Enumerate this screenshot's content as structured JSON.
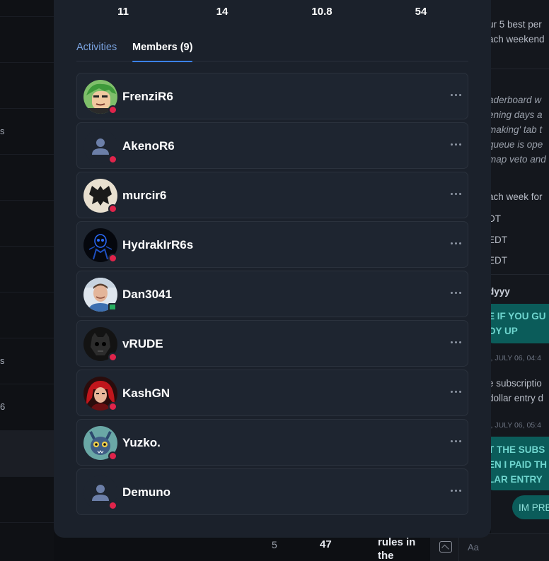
{
  "background": {
    "left_fragments": [
      "s",
      "s",
      "6"
    ],
    "right_lines": [
      {
        "text": "ur 5 best per",
        "style": "normal"
      },
      {
        "text": "ach weekend",
        "style": "normal"
      },
      {
        "text": "aderboard w",
        "style": "i"
      },
      {
        "text": "ening days a",
        "style": "i"
      },
      {
        "text": "making' tab t",
        "style": "i"
      },
      {
        "text": "queue is ope",
        "style": "i"
      },
      {
        "text": "map veto and",
        "style": "i"
      },
      {
        "text": "ach week for",
        "style": "normal"
      },
      {
        "text": "DT",
        "style": "normal"
      },
      {
        "text": " EDT",
        "style": "normal"
      },
      {
        "text": "EDT",
        "style": "normal"
      },
      {
        "text": "dyyy",
        "style": "b"
      },
      {
        "text": "E IF YOU GU",
        "style": "teal"
      },
      {
        "text": "OY UP",
        "style": "teal"
      },
      {
        "text": "), JULY 06, 04:4",
        "style": "date"
      },
      {
        "text": "e subscriptio",
        "style": "normal"
      },
      {
        "text": "dollar entry d",
        "style": "normal"
      },
      {
        "text": "), JULY 06, 05:4",
        "style": "date"
      },
      {
        "text": "T THE SUBS",
        "style": "teal"
      },
      {
        "text": "EN I PAID TH",
        "style": "teal"
      },
      {
        "text": "LAR ENTRY",
        "style": "teal"
      }
    ],
    "im_pill": "IM PRE",
    "bottom_cells": [
      "5",
      "47"
    ],
    "rules_text": "rules in the competit",
    "composer_placeholder": "Aa"
  },
  "stats": [
    "11",
    "14",
    "10.8",
    "54"
  ],
  "tabs": {
    "activities": "Activities",
    "members": "Members (9)"
  },
  "members": [
    {
      "name": "FrenziR6",
      "avatar": "anime-green-hair",
      "status": "dnd"
    },
    {
      "name": "AkenoR6",
      "avatar": "default-user",
      "status": "dnd"
    },
    {
      "name": "murcir6",
      "avatar": "bat-silhouette",
      "status": "dnd"
    },
    {
      "name": "HydrakIrR6s",
      "avatar": "blue-skeleton",
      "status": "dnd"
    },
    {
      "name": "Dan3041",
      "avatar": "photo-person",
      "status": "desktop"
    },
    {
      "name": "vRUDE",
      "avatar": "dark-skull",
      "status": "dnd"
    },
    {
      "name": "KashGN",
      "avatar": "red-hair-anime",
      "status": "dnd"
    },
    {
      "name": "Yuzko.",
      "avatar": "blue-creature",
      "status": "dnd"
    },
    {
      "name": "Demuno",
      "avatar": "default-user",
      "status": "dnd"
    }
  ],
  "colors": {
    "modal_bg": "#1b212b",
    "card_bg": "#1e2530",
    "dnd": "#e0244b",
    "online_desktop": "#27ae60",
    "tab_active_underline": "#3b82f6",
    "tab_inactive": "#7aa3e0"
  }
}
